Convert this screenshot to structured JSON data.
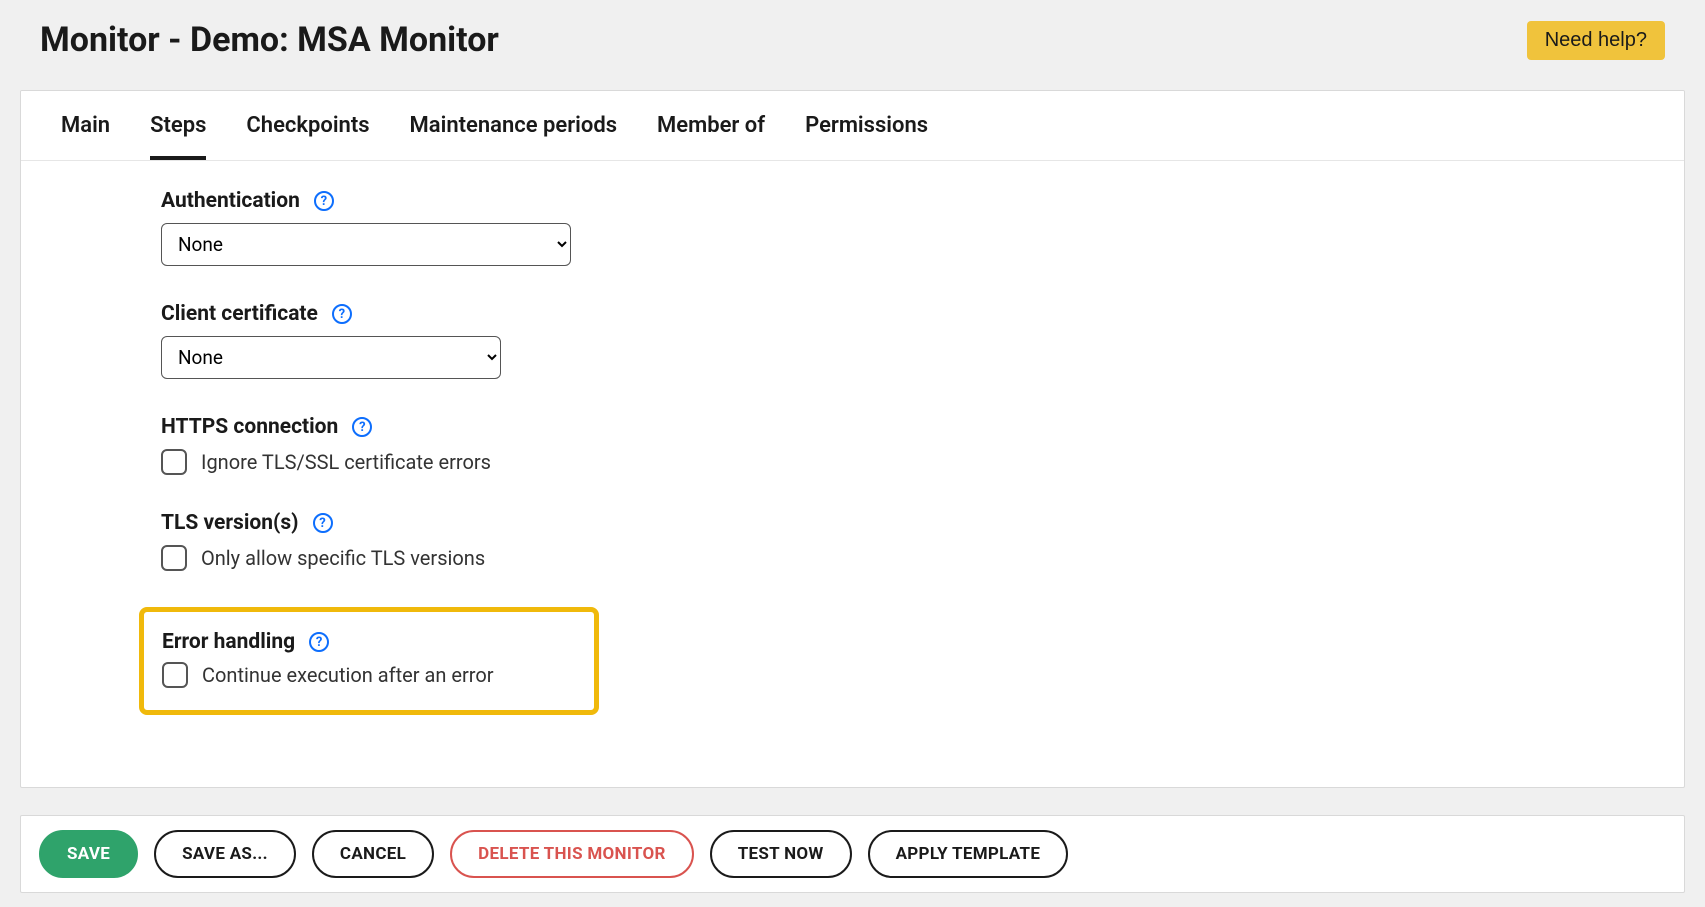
{
  "header": {
    "title": "Monitor - Demo: MSA Monitor",
    "help_label": "Need help?"
  },
  "tabs": [
    {
      "label": "Main",
      "active": false
    },
    {
      "label": "Steps",
      "active": true
    },
    {
      "label": "Checkpoints",
      "active": false
    },
    {
      "label": "Maintenance periods",
      "active": false
    },
    {
      "label": "Member of",
      "active": false
    },
    {
      "label": "Permissions",
      "active": false
    }
  ],
  "sections": {
    "authentication": {
      "label": "Authentication",
      "value": "None"
    },
    "client_certificate": {
      "label": "Client certificate",
      "value": "None"
    },
    "https_connection": {
      "label": "HTTPS connection",
      "checkbox_label": "Ignore TLS/SSL certificate errors"
    },
    "tls_versions": {
      "label": "TLS version(s)",
      "checkbox_label": "Only allow specific TLS versions"
    },
    "error_handling": {
      "label": "Error handling",
      "checkbox_label": "Continue execution after an error"
    }
  },
  "footer": {
    "save": "SAVE",
    "save_as": "SAVE AS...",
    "cancel": "CANCEL",
    "delete": "DELETE THIS MONITOR",
    "test_now": "TEST NOW",
    "apply_template": "APPLY TEMPLATE"
  }
}
